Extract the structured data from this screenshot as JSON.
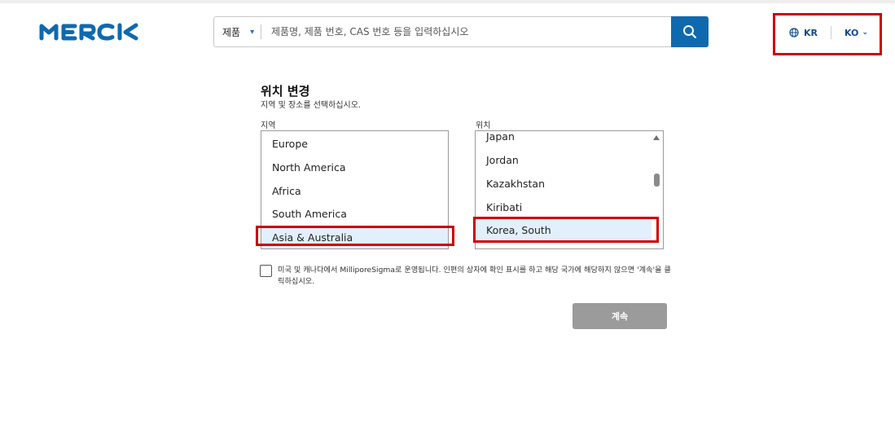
{
  "header": {
    "logo_text": "MERCK",
    "search": {
      "category": "제품",
      "placeholder": "제품명, 제품 번호, CAS 번호 등을 입력하십시오"
    },
    "locale": {
      "country": "KR",
      "language": "KO"
    }
  },
  "main": {
    "title": "위치 변경",
    "subtitle": "지역 및 장소를 선택하십시오.",
    "region_label": "지역",
    "location_label": "위치",
    "regions": [
      "Europe",
      "North America",
      "Africa",
      "South America",
      "Asia & Australia"
    ],
    "selected_region": "Asia & Australia",
    "locations": [
      "Japan",
      "Jordan",
      "Kazakhstan",
      "Kiribati",
      "Korea, South"
    ],
    "selected_location": "Korea, South",
    "notice": "미국 및 캐나다에서 MilliporeSigma로 운영됩니다. 인편의 상자에 확인 표시를 하고 해당 국가에 해당하지 않으면 '계속'을 클릭하십시오.",
    "continue_label": "계속"
  },
  "colors": {
    "brand_blue": "#0f69af",
    "highlight_red": "#d00000",
    "selected_bg": "#e2f0fd",
    "button_disabled": "#9b9b9b"
  }
}
